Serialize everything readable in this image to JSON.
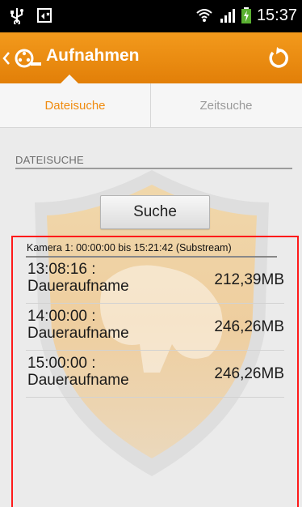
{
  "status_bar": {
    "time": "15:37",
    "icons": [
      "usb-icon",
      "cast-icon",
      "wifi-icon",
      "signal-icon",
      "battery-charging-icon"
    ]
  },
  "action_bar": {
    "title": "Aufnahmen",
    "back_icon": "chevron-left-icon",
    "app_icon": "camera-reel-icon",
    "refresh_icon": "refresh-icon",
    "accent": "#f08c10"
  },
  "tabs": [
    {
      "label": "Dateisuche",
      "active": true
    },
    {
      "label": "Zeitsuche",
      "active": false
    }
  ],
  "section": {
    "header": "DATEISUCHE",
    "search_button": "Suche"
  },
  "results": {
    "camera_line": "Kamera 1: 00:00:00 bis 15:21:42 (Substream)",
    "highlight_color": "#ff1a1a",
    "items": [
      {
        "time": "13:08:16 :",
        "kind": "Daueraufname",
        "size": "212,39MB"
      },
      {
        "time": "14:00:00 :",
        "kind": "Daueraufname",
        "size": "246,26MB"
      },
      {
        "time": "15:00:00 :",
        "kind": "Daueraufname",
        "size": "246,26MB"
      }
    ]
  }
}
